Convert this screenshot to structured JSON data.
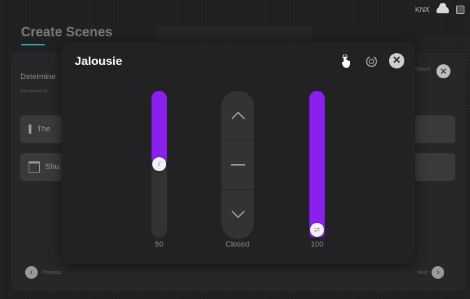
{
  "status": {
    "knx_label": "KNX",
    "cloud_icon": "cloud-icon",
    "box_icon": "square-icon"
  },
  "page": {
    "title": "Create Scenes"
  },
  "background": {
    "determine_label": "Determine",
    "now_label": "Now please ch",
    "rows": [
      {
        "label": "The",
        "icon": "thermometer-icon"
      },
      {
        "label": "Shu",
        "icon": "shutter-icon"
      }
    ],
    "cancel_label": "Cancel",
    "previous_label": "Previous",
    "next_label": "Next"
  },
  "dialog": {
    "title": "Jalousie",
    "tap_icon": "tap-hand-icon",
    "rotate_icon": "rotate-icon",
    "close_icon": "close-icon",
    "slat_value": 50,
    "slat_label": "50",
    "control_state_label": "Closed",
    "position_value": 100,
    "position_label": "100",
    "accent_color": "#8a1ff0"
  }
}
